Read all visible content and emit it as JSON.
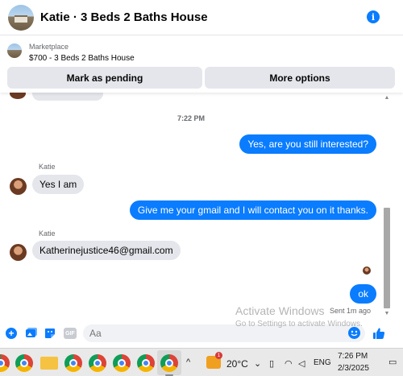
{
  "header": {
    "title": "Katie · 3 Beds 2 Baths House",
    "info_icon": "info-icon",
    "info_glyph": "i"
  },
  "marketplace": {
    "label": "Marketplace",
    "listing": "$700 - 3 Beds 2 Baths House",
    "buttons": {
      "pending": "Mark as pending",
      "options": "More options"
    }
  },
  "chat": {
    "timestamp": "7:22 PM",
    "messages": [
      {
        "direction": "outgoing",
        "text": "Yes, are you still interested?"
      },
      {
        "direction": "incoming",
        "sender": "Katie",
        "text": "Yes I am"
      },
      {
        "direction": "outgoing",
        "text": "Give me your gmail and I will contact you on it thanks."
      },
      {
        "direction": "incoming",
        "sender": "Katie",
        "text": "Katherinejustice46@gmail.com"
      },
      {
        "direction": "outgoing",
        "text": "ok"
      }
    ],
    "sent_status": "Sent 1m ago"
  },
  "watermark": {
    "line1": "Activate Windows",
    "line2": "Go to Settings to activate Windows."
  },
  "composer": {
    "placeholder": "Aa",
    "icons": [
      "plus-icon",
      "photo-icon",
      "sticker-icon",
      "gif-icon",
      "emoji-icon",
      "like-icon"
    ],
    "gif_label": "GIF",
    "plus_glyph": "+"
  },
  "taskbar": {
    "weather": {
      "temp": "20°C",
      "badge": "1"
    },
    "language": "ENG",
    "time": "7:26 PM",
    "date": "2/3/2025",
    "tray_chevron": "^"
  },
  "colors": {
    "accent": "#0a7cff",
    "incoming_bubble": "#e4e6eb"
  }
}
